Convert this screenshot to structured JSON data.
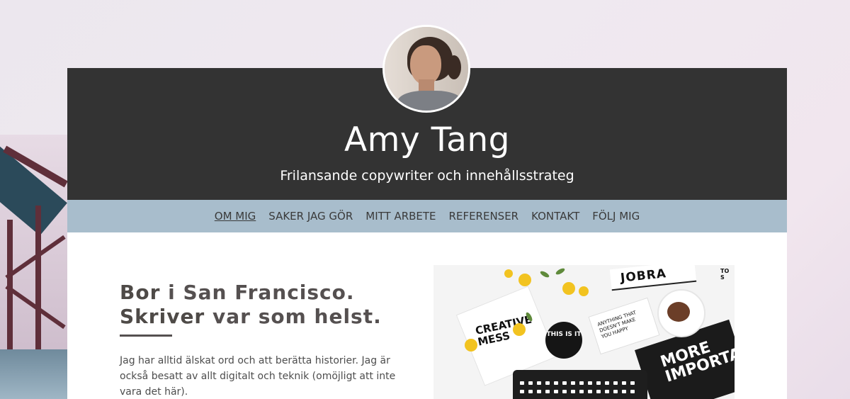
{
  "profile": {
    "name": "Amy Tang",
    "tagline": "Frilansande copywriter och innehållsstrateg"
  },
  "nav": {
    "items": [
      {
        "label": "OM MIG",
        "active": true
      },
      {
        "label": "SAKER JAG GÖR",
        "active": false
      },
      {
        "label": "MITT ARBETE",
        "active": false
      },
      {
        "label": "REFERENSER",
        "active": false
      },
      {
        "label": "KONTAKT",
        "active": false
      },
      {
        "label": "FÖLJ MIG",
        "active": false
      }
    ]
  },
  "about": {
    "line1_bold": "Bor",
    "line1_rest": " i San Francisco.",
    "line2_bold": "Skriver",
    "line2_rest": " var som helst.",
    "paragraph": "Jag har alltid älskat ord och att berätta historier. Jag är också besatt av allt digitalt och teknik (omöjligt att inte vara det här)."
  },
  "photo_text": {
    "creative_mess": "CREATIVE MESS",
    "this_is_it": "THIS IS IT",
    "anything": "ANYTHING THAT DOESN'T MAKE YOU HAPPY",
    "more_important": "MORE IMPORTANT",
    "top_banner": "JOBRA",
    "corner": "TO S"
  },
  "colors": {
    "header_bg": "#333333",
    "nav_bg": "#a8bdcc",
    "card_bg": "#ffffff",
    "text_dark": "#555050"
  }
}
